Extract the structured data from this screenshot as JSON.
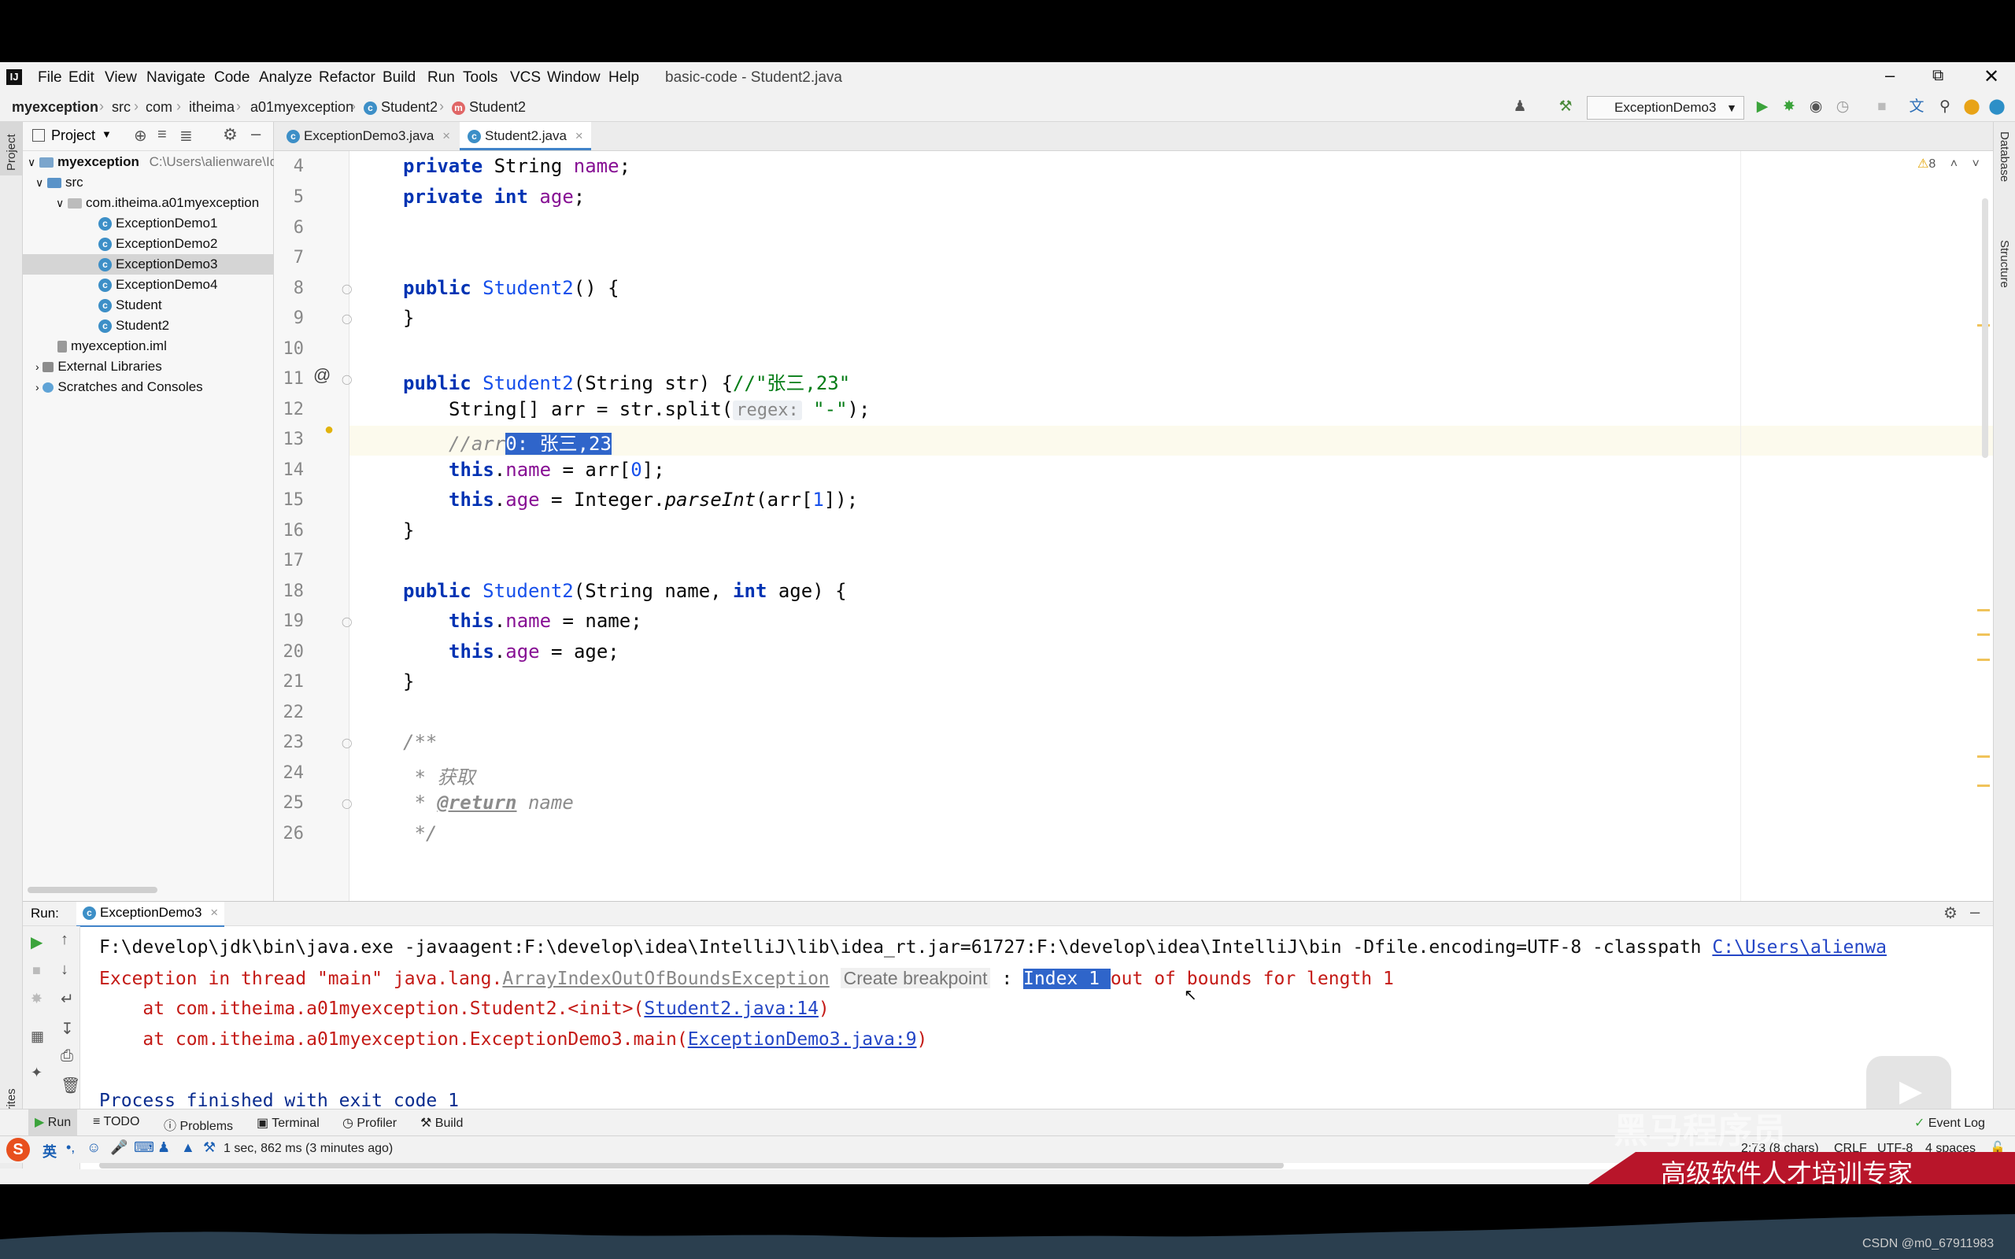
{
  "window": {
    "title": "basic-code - Student2.java"
  },
  "menu": [
    "File",
    "Edit",
    "View",
    "Navigate",
    "Code",
    "Analyze",
    "Refactor",
    "Build",
    "Run",
    "Tools",
    "VCS",
    "Window",
    "Help"
  ],
  "breadcrumb": [
    "myexception",
    "src",
    "com",
    "itheima",
    "a01myexception",
    "Student2",
    "Student2"
  ],
  "run_config": "ExceptionDemo3",
  "project_panel": {
    "title": "Project",
    "root": "myexception",
    "root_path": "C:\\Users\\alienware\\Id",
    "items": [
      {
        "label": "src"
      },
      {
        "label": "com.itheima.a01myexception"
      },
      {
        "label": "ExceptionDemo1"
      },
      {
        "label": "ExceptionDemo2"
      },
      {
        "label": "ExceptionDemo3"
      },
      {
        "label": "ExceptionDemo4"
      },
      {
        "label": "Student"
      },
      {
        "label": "Student2"
      },
      {
        "label": "myexception.iml"
      },
      {
        "label": "External Libraries"
      },
      {
        "label": "Scratches and Consoles"
      }
    ]
  },
  "editor_tabs": [
    "ExceptionDemo3.java",
    "Student2.java"
  ],
  "warnings": "8",
  "side_labels": {
    "project": "Project",
    "favorites": "Favorites",
    "database": "Database",
    "structure": "Structure"
  },
  "code": {
    "line_numbers": [
      "4",
      "5",
      "6",
      "7",
      "8",
      "9",
      "10",
      "11",
      "12",
      "13",
      "14",
      "15",
      "16",
      "17",
      "18",
      "19",
      "20",
      "21",
      "22",
      "23",
      "24",
      "25",
      "26"
    ],
    "l4": {
      "kw": "private",
      "cls": "String",
      "id": "name",
      "end": ";"
    },
    "l5": {
      "kw1": "private",
      "kw2": "int",
      "id": "age",
      "end": ";"
    },
    "l8": {
      "kw": "public",
      "name": "Student2",
      "end": "() {"
    },
    "l9": "}",
    "l11": {
      "kw": "public",
      "name": "Student2",
      "params": "(String str) {",
      "cmt": "//\"张三,23\""
    },
    "l12": {
      "pre": "String[] arr = str.split(",
      "hint": "regex:",
      "str": "\"-\"",
      "end": ");"
    },
    "l13": {
      "cmt": "//arr",
      "sel": "0: 张三,23"
    },
    "l14": {
      "kw": "this",
      "pre": ".",
      "id": "name",
      "mid": " = arr[",
      "num": "0",
      "end": "];"
    },
    "l15": {
      "kw": "this",
      "pre": ".",
      "id": "age",
      "mid": " = Integer.",
      "call": "parseInt",
      "mid2": "(arr[",
      "num": "1",
      "end": "]);"
    },
    "l16": "}",
    "l18": {
      "kw": "public",
      "name": "Student2",
      "p1": "(String name, ",
      "kw2": "int",
      "p2": " age) {"
    },
    "l19": {
      "kw": "this",
      "pre": ".",
      "id": "name",
      "end": " = name;"
    },
    "l20": {
      "kw": "this",
      "pre": ".",
      "id": "age",
      "end": " = age;"
    },
    "l21": "}",
    "l23": "/**",
    "l24": " * 获取",
    "l25": {
      "pre": " * ",
      "tag": "@return",
      "end": " name"
    },
    "l26": " */"
  },
  "run_panel": {
    "label": "Run:",
    "tab": "ExceptionDemo3",
    "cmd_text": "F:\\develop\\jdk\\bin\\java.exe -javaagent:F:\\develop\\idea\\IntelliJ\\lib\\idea_rt.jar=61727:F:\\develop\\idea\\IntelliJ\\bin -Dfile.encoding=UTF-8 -classpath ",
    "cmd_link": "C:\\Users\\alienwa",
    "exc_pre": "Exception in thread \"main\" java.lang.",
    "exc_class": "ArrayIndexOutOfBoundsException",
    "exc_hint": "Create breakpoint",
    "exc_colon": " : ",
    "exc_sel": "Index 1 ",
    "exc_msg": "out of bounds for length 1",
    "at1_pre": "    at com.itheima.a01myexception.Student2.<init>(",
    "at1_link": "Student2.java:14",
    "at2_pre": "    at com.itheima.a01myexception.ExceptionDemo3.main(",
    "at2_link": "ExceptionDemo3.java:9",
    "close": ")",
    "exit": "Process finished with exit code 1"
  },
  "bottom_tabs": [
    "Run",
    "TODO",
    "Problems",
    "Terminal",
    "Profiler",
    "Build"
  ],
  "event_log": "Event Log",
  "status": {
    "left": "1 sec, 862 ms (3 minutes ago)",
    "position": "2:73 (8 chars)",
    "line_sep": "CRLF",
    "encoding": "UTF-8",
    "indent": "4 spaces"
  },
  "ime_label": "英",
  "banner": "高级软件人才培训专家",
  "watermark_text": "黑马程序员",
  "csdn": "CSDN @m0_67911983"
}
